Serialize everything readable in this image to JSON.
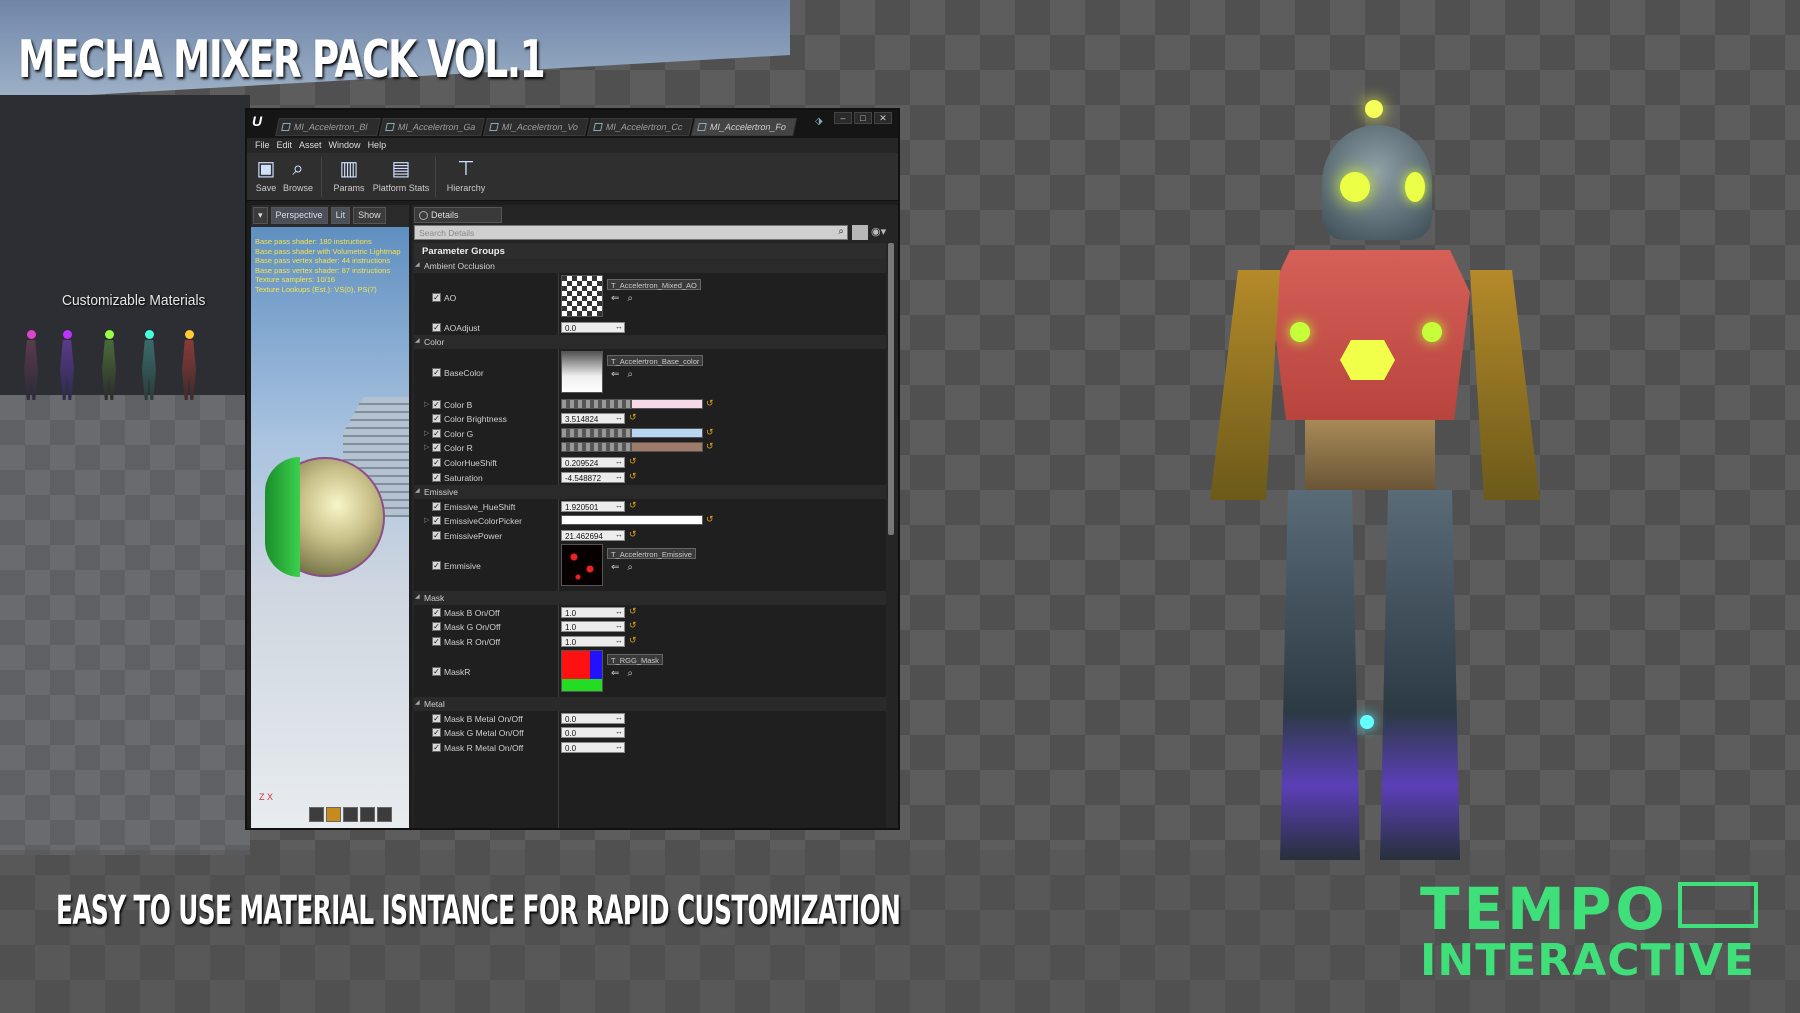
{
  "promo": {
    "title": "MECHA MIXER PACK VOL.1",
    "tagline": "EASY TO USE MATERIAL ISNTANCE FOR RAPID CUSTOMIZATION",
    "scene_label": "Customizable Materials",
    "logo_line1": "TEMPO",
    "logo_line2": "INTERACTIVE"
  },
  "editor": {
    "tabs": [
      "MI_Accelertron_Bl",
      "MI_Accelertron_Ga",
      "MI_Accelertron_Vo",
      "MI_Accelertron_Cc",
      "MI_Accelertron_Fo"
    ],
    "menu": [
      "File",
      "Edit",
      "Asset",
      "Window",
      "Help"
    ],
    "toolbar": {
      "save": "Save",
      "browse": "Browse",
      "params": "Params",
      "platform_stats": "Platform Stats",
      "hierarchy": "Hierarchy"
    },
    "viewport": {
      "dropdown": "▾",
      "perspective": "Perspective",
      "lit": "Lit",
      "show": "Show",
      "stats": [
        "Base pass shader: 180 instructions",
        "Base pass shader with Volumetric Lightmap",
        "Base pass vertex shader: 44 instructions",
        "Base pass vertex shader: 87 instructions",
        "Texture samplers: 10/16",
        "Texture Lookups (Est.): VS(0), PS(7)"
      ],
      "axis": "Z X"
    },
    "details": {
      "tab": "Details",
      "search_placeholder": "Search Details",
      "parameter_groups": "Parameter Groups",
      "categories": {
        "ao": "Ambient Occlusion",
        "color": "Color",
        "emissive": "Emissive",
        "mask": "Mask",
        "metal": "Metal"
      },
      "params": {
        "ao": {
          "label": "AO",
          "texture": "T_Accelertron_Mixed_AO"
        },
        "ao_adjust": {
          "label": "AOAdjust",
          "value": "0.0"
        },
        "base_color": {
          "label": "BaseColor",
          "texture": "T_Accelertron_Base_color"
        },
        "color_b": {
          "label": "Color B",
          "color": "#f7d8ea"
        },
        "color_brightness": {
          "label": "Color Brightness",
          "value": "3.514824"
        },
        "color_g": {
          "label": "Color G",
          "color": "#b6d6f1"
        },
        "color_r": {
          "label": "Color R",
          "color": "#a07b6a"
        },
        "color_hue_shift": {
          "label": "ColorHueShift",
          "value": "0.209524"
        },
        "saturation": {
          "label": "Saturation",
          "value": "-4.548872"
        },
        "emissive_hue_shift": {
          "label": "Emissive_HueShift",
          "value": "1.920501"
        },
        "emissive_color_picker": {
          "label": "EmissiveColorPicker",
          "color": "#ffffff"
        },
        "emissive_power": {
          "label": "EmissivePower",
          "value": "21.462694"
        },
        "emmisive": {
          "label": "Emmisive",
          "texture": "T_Accelertron_Emissive"
        },
        "mask_b": {
          "label": "Mask B On/Off",
          "value": "1.0"
        },
        "mask_g": {
          "label": "Mask G On/Off",
          "value": "1.0"
        },
        "mask_r": {
          "label": "Mask R On/Off",
          "value": "1.0"
        },
        "mask_rgb": {
          "label": "MaskR",
          "texture": "T_RGG_Mask"
        },
        "metal_b": {
          "label": "Mask B Metal On/Off",
          "value": "0.0"
        },
        "metal_g": {
          "label": "Mask G Metal On/Off",
          "value": "0.0"
        },
        "metal_r": {
          "label": "Mask R Metal On/Off",
          "value": "0.0"
        }
      }
    }
  }
}
